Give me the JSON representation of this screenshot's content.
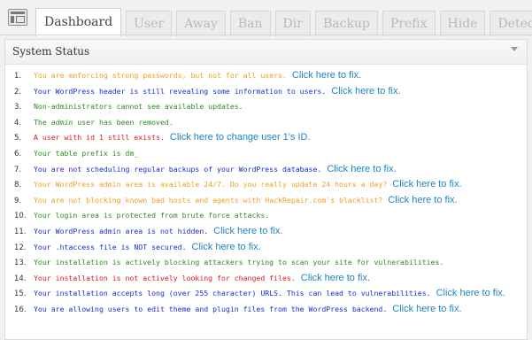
{
  "tabs": [
    {
      "label": "Dashboard",
      "active": true
    },
    {
      "label": "User",
      "active": false
    },
    {
      "label": "Away",
      "active": false
    },
    {
      "label": "Ban",
      "active": false
    },
    {
      "label": "Dir",
      "active": false
    },
    {
      "label": "Backup",
      "active": false
    },
    {
      "label": "Prefix",
      "active": false
    },
    {
      "label": "Hide",
      "active": false
    },
    {
      "label": "Detect",
      "active": false
    }
  ],
  "panel": {
    "title": "System Status"
  },
  "colors": {
    "orange": "#f0a020",
    "blue": "#1a2dd3",
    "green": "#2e8b22",
    "red": "#e01818",
    "link": "#2184c1"
  },
  "items": [
    {
      "num": "1.",
      "text": "You are enforcing strong passwords, but not for all users.",
      "color": "orange",
      "link": "Click here to fix."
    },
    {
      "num": "2.",
      "text": "Your WordPress header is still revealing some information to users.",
      "color": "blue",
      "link": "Click here to fix."
    },
    {
      "num": "3.",
      "text": "Non-administrators cannot see available updates.",
      "color": "green",
      "link": ""
    },
    {
      "num": "4.",
      "text_before": "The ",
      "text_em": "admin",
      "text_after": " user has been removed.",
      "color": "green",
      "link": ""
    },
    {
      "num": "5.",
      "text": "A user with id 1 still exists.",
      "color": "red",
      "link": "Click here to change user 1's ID."
    },
    {
      "num": "6.",
      "text": "Your table prefix is dm_",
      "color": "green",
      "link": ""
    },
    {
      "num": "7.",
      "text": "You are not scheduling regular backups of your WordPress database.",
      "color": "blue",
      "link": "Click here to fix."
    },
    {
      "num": "8.",
      "text": "Your WordPress admin area is available 24/7. Do you really update 24 hours a day?",
      "color": "orange",
      "link": "Click here to fix."
    },
    {
      "num": "9.",
      "text": "You are not blocking known bad hosts and agents with HackRepair.com's blacklist?",
      "color": "orange",
      "link": "Click here to fix."
    },
    {
      "num": "10.",
      "text": "Your login area is protected from brute force attacks.",
      "color": "green",
      "link": ""
    },
    {
      "num": "11.",
      "text": "Your WordPress admin area is not hidden.",
      "color": "blue",
      "link": "Click here to fix."
    },
    {
      "num": "12.",
      "text": "Your .htaccess file is NOT secured.",
      "color": "blue",
      "link": "Click here to fix."
    },
    {
      "num": "13.",
      "text": "Your installation is actively blocking attackers trying to scan your site for vulnerabilities.",
      "color": "green",
      "link": ""
    },
    {
      "num": "14.",
      "text": "Your installation is not actively looking for changed files.",
      "color": "red",
      "link": "Click here to fix."
    },
    {
      "num": "15.",
      "text": "Your installation accepts long (over 255 character) URLS. This can lead to vulnerabilities.",
      "color": "blue",
      "link": "Click here to fix."
    },
    {
      "num": "16.",
      "text": "You are allowing users to edit theme and plugin files from the WordPress backend.",
      "color": "blue",
      "link": "Click here to fix."
    }
  ]
}
